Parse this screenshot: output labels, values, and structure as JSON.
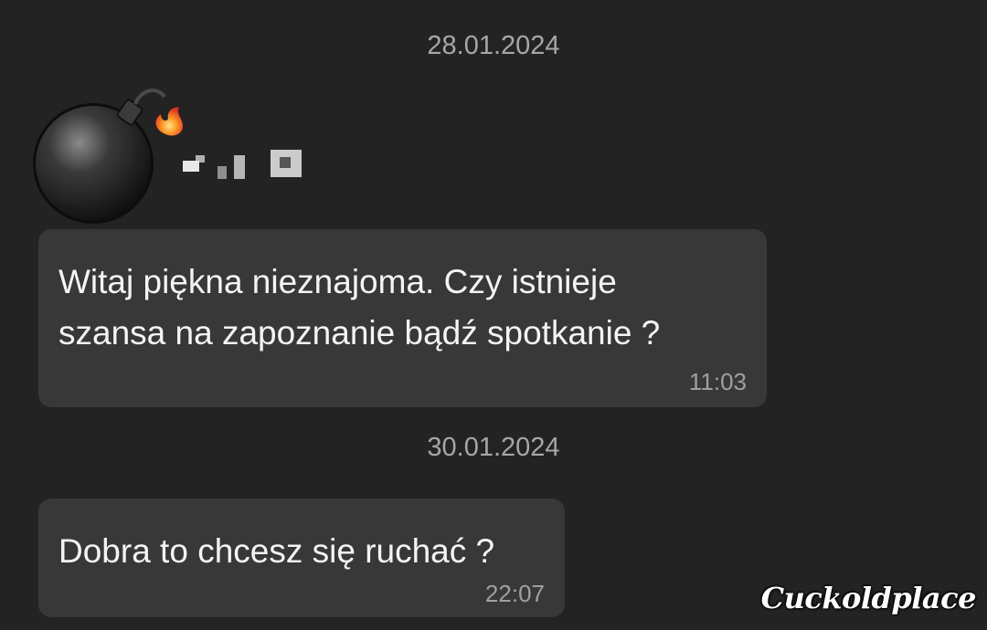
{
  "conversation": {
    "groups": [
      {
        "date": "28.01.2024",
        "sender": {
          "avatar_icon": "bomb-icon",
          "name_redacted": true
        },
        "messages": [
          {
            "lines": [
              "Witaj piękna nieznajoma. Czy istnieje",
              "szansa na zapoznanie bądź spotkanie ?"
            ],
            "time": "11:03"
          }
        ]
      },
      {
        "date": "30.01.2024",
        "messages": [
          {
            "lines": [
              "Dobra to chcesz się ruchać ?"
            ],
            "time": "22:07"
          }
        ]
      }
    ]
  },
  "watermark": "Cuckoldplace",
  "colors": {
    "background": "#232323",
    "bubble": "#383838",
    "date_text": "#a7a7a7",
    "time_text": "#a0a0a0"
  }
}
